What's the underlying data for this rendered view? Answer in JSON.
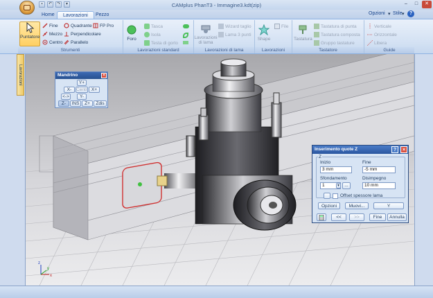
{
  "window": {
    "title": "CAMplus PhanT3 - Immagine3.kdt(zip)",
    "controls": {
      "minimize": "–",
      "maximize": "□",
      "close": "✕"
    }
  },
  "ribbon_tabs": [
    {
      "label": "Home",
      "active": false
    },
    {
      "label": "Lavorazioni",
      "active": true
    },
    {
      "label": "Pezzo",
      "active": false
    }
  ],
  "ribbon_right": {
    "options": "Opzioni",
    "style": "Stile",
    "help": "?"
  },
  "groups": {
    "strumenti": {
      "label": "Strumenti",
      "big_button": "Puntatore",
      "items": [
        "Fine",
        "Quadrante",
        "FP Pro",
        "Mezzo",
        "Perpendicolare",
        "Centro",
        "Parallelo"
      ]
    },
    "lav_standard": {
      "label": "Lavorazioni standard",
      "big_button": "Foro",
      "items": [
        "Tasca",
        "Isola",
        "Testa di gorto"
      ]
    },
    "lav_lama": {
      "label": "Lavorazioni di lama",
      "big_button": "Lavorazioni di lama",
      "items": [
        "Wizard taglio",
        "Lama 3 punti"
      ]
    },
    "lav_speciali": {
      "label": "Lavorazioni speciali",
      "big_button": "Shape",
      "items": [
        "File"
      ]
    },
    "tastatore": {
      "label": "Tastatore",
      "big_button": "Tastatura",
      "items": [
        "Tastatura di punta",
        "Tastatura composta",
        "Gruppo tastature"
      ]
    },
    "guide": {
      "label": "Guide",
      "items": [
        "Verticale",
        "Orizzontale",
        "Libera"
      ]
    }
  },
  "sidebar_tab": "Lavorazioni",
  "mandrino": {
    "title": "Mandrino",
    "buttons": [
      "Y+",
      "X-",
      "Centr",
      "X+",
      "<->",
      "Y-",
      "Z-",
      "INS",
      "Z+",
      "Zdis"
    ]
  },
  "quote_z": {
    "title": "Inserimento quote Z",
    "section": "Z",
    "inizio_label": "Inizio",
    "inizio_value": "3 mm",
    "fine_label": "Fine",
    "fine_value": "-5 mm",
    "sfondamento_label": "Sfondamento",
    "sfondamento_value": "1",
    "disimpegno_label": "Disimpegno",
    "disimpegno_value": "10 mm",
    "offset_label": "Offset spessore lama",
    "offset_checked": false,
    "buttons": {
      "opzioni": "Opzioni",
      "muovi": "Muovi...",
      "y": "Y",
      "prev": "<<",
      "next": ">>",
      "fine": "Fine",
      "annulla": "Annulla",
      "ellipsis": "..."
    }
  },
  "axis_labels": {
    "x": "x",
    "y": "y",
    "z": "z"
  },
  "colors": {
    "ribbon_text": "#15428b",
    "dialog_header": "#27508f",
    "accent_pointer": "#ffd063"
  }
}
